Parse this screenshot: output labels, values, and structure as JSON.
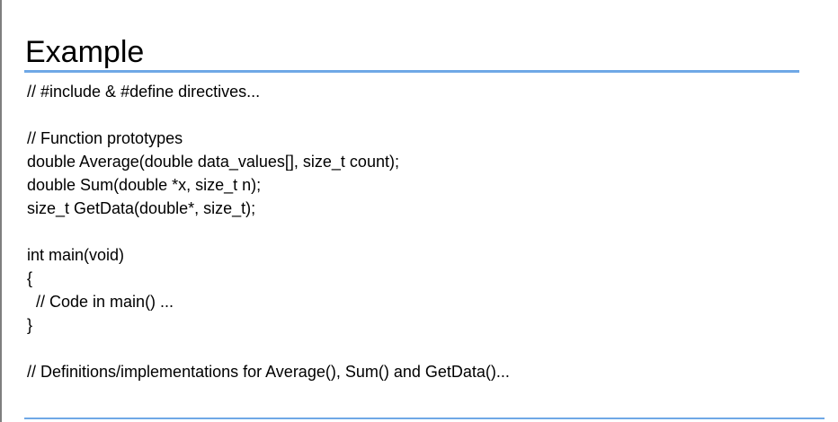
{
  "slide": {
    "title": "Example",
    "lines": [
      "// #include & #define directives...",
      "",
      "// Function prototypes",
      "double Average(double data_values[], size_t count);",
      "double Sum(double *x, size_t n);",
      "size_t GetData(double*, size_t);",
      "",
      "int main(void)",
      "{",
      "  // Code in main() ...",
      "}",
      "",
      "// Definitions/implementations for Average(), Sum() and GetData()..."
    ]
  },
  "colors": {
    "accent": "#6fa8e6",
    "text": "#000000",
    "background": "#ffffff"
  }
}
